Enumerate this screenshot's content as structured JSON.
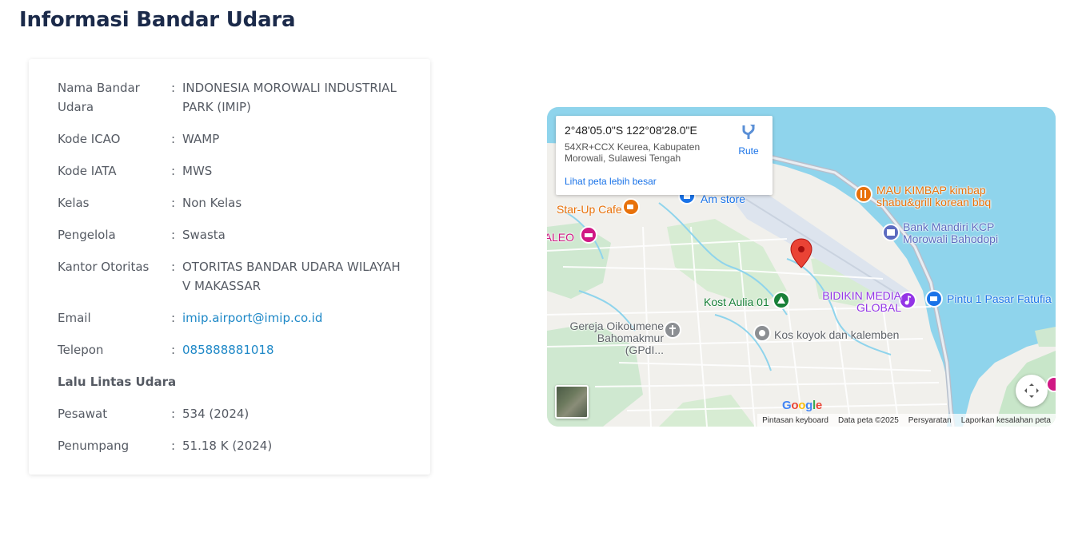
{
  "page": {
    "title": "Informasi Bandar Udara"
  },
  "info": {
    "rows": [
      {
        "label": "Nama Bandar Udara",
        "value": "INDONESIA MOROWALI INDUSTRIAL PARK (IMIP)"
      },
      {
        "label": "Kode ICAO",
        "value": "WAMP"
      },
      {
        "label": "Kode IATA",
        "value": "MWS"
      },
      {
        "label": "Kelas",
        "value": "Non Kelas"
      },
      {
        "label": "Pengelola",
        "value": "Swasta"
      },
      {
        "label": "Kantor Otoritas",
        "value": "OTORITAS BANDAR UDARA WILAYAH V MAKASSAR"
      },
      {
        "label": "Email",
        "value": "imip.airport@imip.co.id"
      },
      {
        "label": "Telepon",
        "value": "085888881018"
      }
    ],
    "separator": ":",
    "traffic_heading": "Lalu Lintas Udara",
    "traffic_rows": [
      {
        "label": "Pesawat",
        "value": "534 (2024)"
      },
      {
        "label": "Penumpang",
        "value": "51.18 K (2024)"
      }
    ]
  },
  "map": {
    "popup": {
      "coordinates": "2°48'05.0\"S 122°08'28.0\"E",
      "address": "54XR+CCX Keurea, Kabupaten Morowali, Sulawesi Tengah",
      "route_label": "Rute",
      "larger_map_link": "Lihat peta lebih besar"
    },
    "pois": [
      {
        "name": "Am store",
        "color": "#1a73e8"
      },
      {
        "name": "Star-Up Cafe",
        "color": "#e8710a"
      },
      {
        "name": "MALEO",
        "color": "#d01884"
      },
      {
        "name": "MAU KIMBAP kimbap shabu&grill korean bbq",
        "color": "#e8710a"
      },
      {
        "name": "Bank Mandiri KCP Morowali Bahodopi",
        "color": "#5c6bc0"
      },
      {
        "name": "BIDIKIN MEDIA GLOBAL",
        "color": "#9334e6"
      },
      {
        "name": "Pintu 1 Pasar Fatufia",
        "color": "#1a73e8"
      },
      {
        "name": "Kost Aulia 01",
        "color": "#188038"
      },
      {
        "name": "Gereja Oikoumene Bahomakmur (GPdI...",
        "color": "#5f6368"
      },
      {
        "name": "Kos koyok dan kalemben",
        "color": "#5f6368"
      }
    ],
    "footer": {
      "keyboard": "Pintasan keyboard",
      "map_data": "Data peta ©2025",
      "terms": "Persyaratan",
      "report": "Laporkan kesalahan peta"
    },
    "logo_text": "Google"
  }
}
